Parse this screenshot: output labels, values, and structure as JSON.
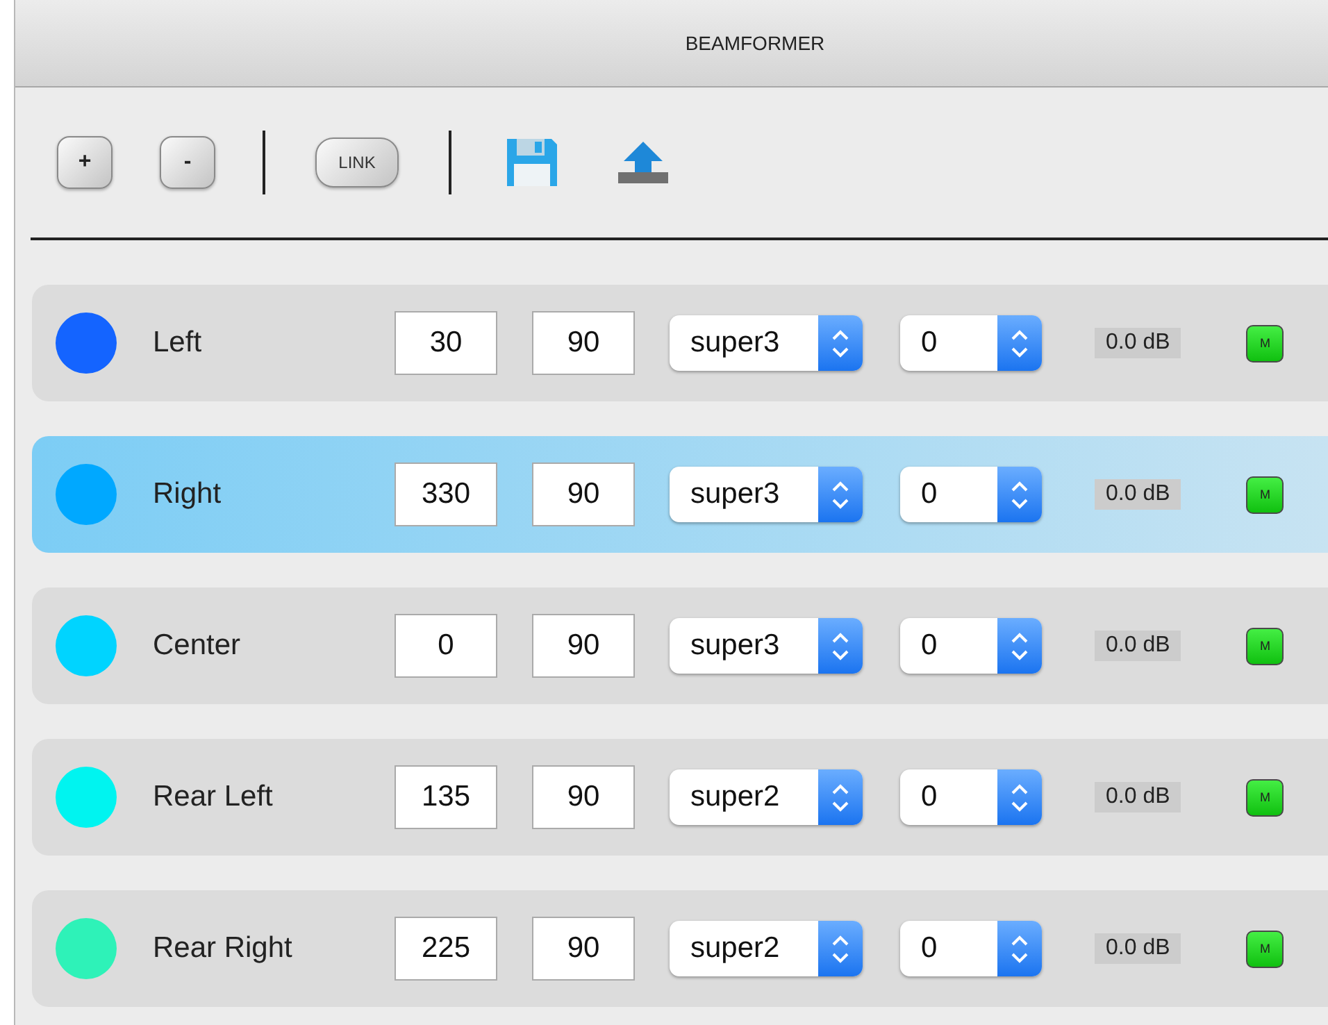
{
  "window": {
    "title": "BEAMFORMER"
  },
  "toolbar": {
    "add": "+",
    "remove": "-",
    "link": "LINK"
  },
  "beams": [
    {
      "name": "Left",
      "color": "#1464ff",
      "selected": false,
      "azimuth": "30",
      "elevation": "90",
      "pattern": "super3",
      "order": "0",
      "gain": "0.0 dB",
      "mute": {
        "label": "M",
        "on": true
      }
    },
    {
      "name": "Right",
      "color": "#00a8ff",
      "selected": true,
      "azimuth": "330",
      "elevation": "90",
      "pattern": "super3",
      "order": "0",
      "gain": "0.0 dB",
      "mute": {
        "label": "M",
        "on": true
      }
    },
    {
      "name": "Center",
      "color": "#00d4ff",
      "selected": false,
      "azimuth": "0",
      "elevation": "90",
      "pattern": "super3",
      "order": "0",
      "gain": "0.0 dB",
      "mute": {
        "label": "M",
        "on": true
      }
    },
    {
      "name": "Rear Left",
      "color": "#00f4f0",
      "selected": false,
      "azimuth": "135",
      "elevation": "90",
      "pattern": "super2",
      "order": "0",
      "gain": "0.0 dB",
      "mute": {
        "label": "M",
        "on": true
      }
    },
    {
      "name": "Rear Right",
      "color": "#2ef2b8",
      "selected": false,
      "azimuth": "225",
      "elevation": "90",
      "pattern": "super2",
      "order": "0",
      "gain": "0.0 dB",
      "mute": {
        "label": "M",
        "on": true
      }
    }
  ]
}
